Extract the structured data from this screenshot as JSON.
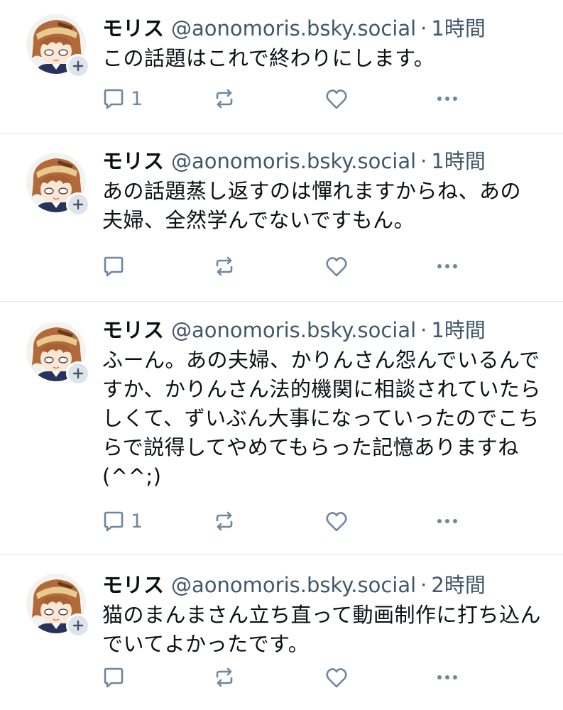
{
  "colors": {
    "name": "#0b0f14",
    "meta": "#42576c",
    "icon": "#6f869f",
    "divider": "#e3e6ea",
    "badge_bg": "#dfe4ea"
  },
  "icons": {
    "reply": "reply-icon",
    "repost": "repost-icon",
    "like": "heart-icon",
    "more": "more-dots-icon",
    "follow": "plus-icon"
  },
  "posts": [
    {
      "display_name": "モリス",
      "handle": "@aonomoris.bsky.social",
      "separator": "·",
      "time": "1時間",
      "text": "この話題はこれで終わりにします。",
      "reply_count": "1"
    },
    {
      "display_name": "モリス",
      "handle": "@aonomoris.bsky.social",
      "separator": "·",
      "time": "1時間",
      "text": "あの話題蒸し返すのは憚れますからね、あの夫婦、全然学んでないですもん。",
      "reply_count": ""
    },
    {
      "display_name": "モリス",
      "handle": "@aonomoris.bsky.social",
      "separator": "·",
      "time": "1時間",
      "text": "ふーん。あの夫婦、かりんさん怨んでいるんですか、かりんさん法的機関に相談されていたらしくて、ずいぶん大事になっていったのでこちらで説得してやめてもらった記憶ありますね(^^;)",
      "reply_count": "1"
    },
    {
      "display_name": "モリス",
      "handle": "@aonomoris.bsky.social",
      "separator": "·",
      "time": "2時間",
      "text": "猫のまんまさん立ち直って動画制作に打ち込んでいてよかったです。",
      "reply_count": ""
    }
  ]
}
